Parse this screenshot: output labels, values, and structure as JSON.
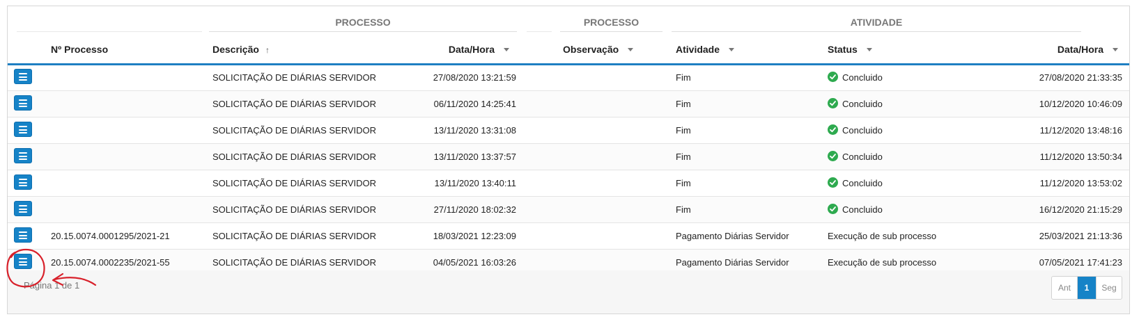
{
  "group_headers": [
    "PROCESSO",
    "PROCESSO",
    "ATIVIDADE"
  ],
  "columns": {
    "numero": "Nº Processo",
    "descricao": "Descrição",
    "descricao_sort": "↑",
    "data_hora": "Data/Hora",
    "observacao": "Observação",
    "atividade": "Atividade",
    "status": "Status",
    "data_hora_atividade": "Data/Hora"
  },
  "rows": [
    {
      "numero": "",
      "descricao": "SOLICITAÇÃO DE DIÁRIAS SERVIDOR",
      "data_hora": "27/08/2020 13:21:59",
      "observacao": "",
      "atividade": "Fim",
      "status": "Concluido",
      "status_icon": "check-circle-icon",
      "data_hora_atividade": "27/08/2020 21:33:35"
    },
    {
      "numero": "",
      "descricao": "SOLICITAÇÃO DE DIÁRIAS SERVIDOR",
      "data_hora": "06/11/2020 14:25:41",
      "observacao": "",
      "atividade": "Fim",
      "status": "Concluido",
      "status_icon": "check-circle-icon",
      "data_hora_atividade": "10/12/2020 10:46:09"
    },
    {
      "numero": "",
      "descricao": "SOLICITAÇÃO DE DIÁRIAS SERVIDOR",
      "data_hora": "13/11/2020 13:31:08",
      "observacao": "",
      "atividade": "Fim",
      "status": "Concluido",
      "status_icon": "check-circle-icon",
      "data_hora_atividade": "11/12/2020 13:48:16"
    },
    {
      "numero": "",
      "descricao": "SOLICITAÇÃO DE DIÁRIAS SERVIDOR",
      "data_hora": "13/11/2020 13:37:57",
      "observacao": "",
      "atividade": "Fim",
      "status": "Concluido",
      "status_icon": "check-circle-icon",
      "data_hora_atividade": "11/12/2020 13:50:34"
    },
    {
      "numero": "",
      "descricao": "SOLICITAÇÃO DE DIÁRIAS SERVIDOR",
      "data_hora": "13/11/2020 13:40:11",
      "observacao": "",
      "atividade": "Fim",
      "status": "Concluido",
      "status_icon": "check-circle-icon",
      "data_hora_atividade": "11/12/2020 13:53:02"
    },
    {
      "numero": "",
      "descricao": "SOLICITAÇÃO DE DIÁRIAS SERVIDOR",
      "data_hora": "27/11/2020 18:02:32",
      "observacao": "",
      "atividade": "Fim",
      "status": "Concluido",
      "status_icon": "check-circle-icon",
      "data_hora_atividade": "16/12/2020 21:15:29"
    },
    {
      "numero": "20.15.0074.0001295/2021-21",
      "descricao": "SOLICITAÇÃO DE DIÁRIAS SERVIDOR",
      "data_hora": "18/03/2021 12:23:09",
      "observacao": "",
      "atividade": "Pagamento Diárias Servidor",
      "status": "Execução de sub processo",
      "status_icon": "",
      "data_hora_atividade": "25/03/2021 21:13:36"
    },
    {
      "numero": "20.15.0074.0002235/2021-55",
      "descricao": "SOLICITAÇÃO DE DIÁRIAS SERVIDOR",
      "data_hora": "04/05/2021 16:03:26",
      "observacao": "",
      "atividade": "Pagamento Diárias Servidor",
      "status": "Execução de sub processo",
      "status_icon": "",
      "data_hora_atividade": "07/05/2021 17:41:23"
    }
  ],
  "row_action_icon": "menu-icon",
  "footer": {
    "page_info": "Página 1 de 1",
    "prev_label": "Ant",
    "current_page": "1",
    "next_label": "Seg"
  },
  "colors": {
    "accent": "#1683c7",
    "success": "#2eaa4f",
    "annotation": "#d8202a"
  }
}
